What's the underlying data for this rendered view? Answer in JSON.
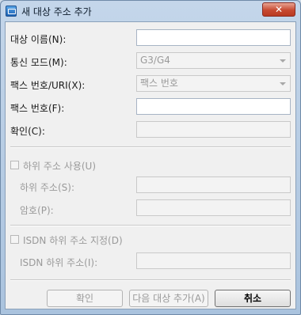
{
  "window": {
    "title": "새 대상 주소 추가",
    "close_glyph": "✕"
  },
  "form": {
    "name_label": "대상 이름(N):",
    "name_value": "",
    "mode_label": "통신 모드(M):",
    "mode_value": "G3/G4",
    "fax_uri_label": "팩스 번호/URI(X):",
    "fax_uri_value": "팩스 번호",
    "fax_number_label": "팩스 번호(F):",
    "fax_number_value": "",
    "confirm_label": "확인(C):",
    "confirm_value": ""
  },
  "subaddress": {
    "use_label": "하위 주소 사용(U)",
    "use_checked": false,
    "subaddress_label": "하위 주소(S):",
    "password_label": "암호(P):"
  },
  "isdn": {
    "use_label": "ISDN 하위 주소 지정(D)",
    "use_checked": false,
    "subaddress_label": "ISDN 하위 주소(I):"
  },
  "buttons": {
    "ok": "확인",
    "add_next": "다음 대상 추가(A)",
    "cancel": "취소"
  },
  "icons": {
    "app": "fax-destination-icon",
    "close": "close-icon",
    "dropdown": "chevron-down-icon"
  }
}
